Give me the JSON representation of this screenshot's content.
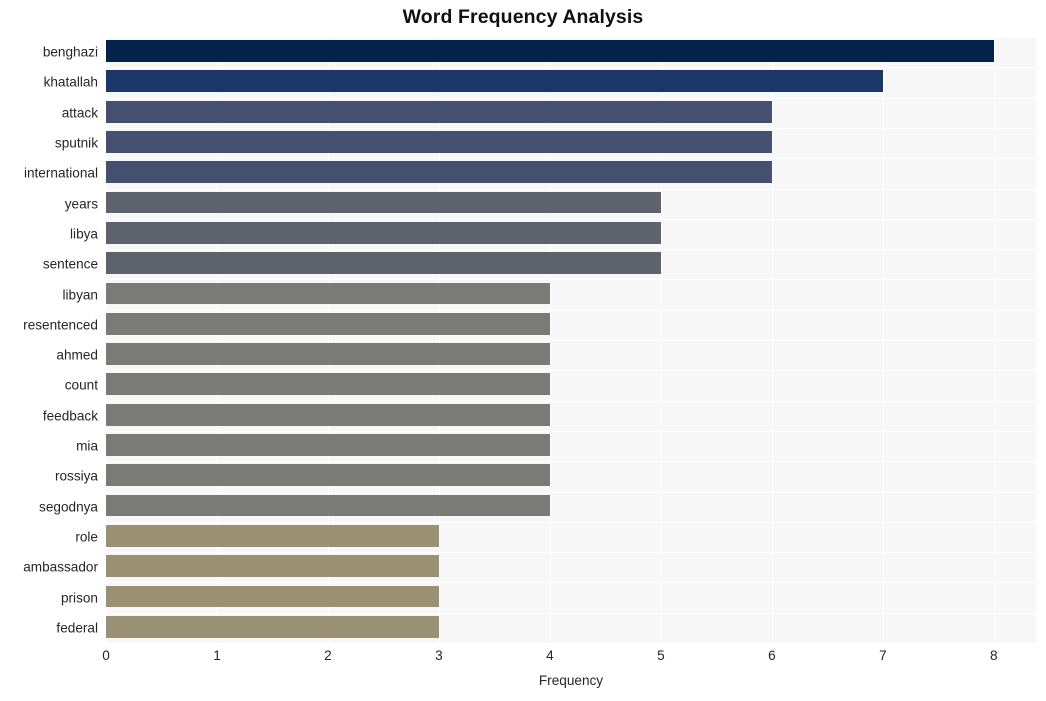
{
  "chart_data": {
    "type": "bar",
    "orientation": "horizontal",
    "title": "Word Frequency Analysis",
    "xlabel": "Frequency",
    "ylabel": "",
    "xlim": [
      0,
      8.38
    ],
    "ylim_categories": 20,
    "grid": true,
    "legend": "none",
    "xticks": [
      0,
      1,
      2,
      3,
      4,
      5,
      6,
      7,
      8
    ],
    "xtick_labels": [
      "0",
      "1",
      "2",
      "3",
      "4",
      "5",
      "6",
      "7",
      "8"
    ],
    "categories": [
      "benghazi",
      "khatallah",
      "attack",
      "sputnik",
      "international",
      "years",
      "libya",
      "sentence",
      "libyan",
      "resentenced",
      "ahmed",
      "count",
      "feedback",
      "mia",
      "rossiya",
      "segodnya",
      "role",
      "ambassador",
      "prison",
      "federal"
    ],
    "values": [
      8,
      7,
      6,
      6,
      6,
      5,
      5,
      5,
      4,
      4,
      4,
      4,
      4,
      4,
      4,
      4,
      3,
      3,
      3,
      3
    ],
    "bar_colors": [
      "#04234c",
      "#1b3669",
      "#455070",
      "#455070",
      "#455070",
      "#5e626d",
      "#5e626d",
      "#5e626d",
      "#7a7a77",
      "#7a7a77",
      "#7a7a77",
      "#7a7a77",
      "#7a7a77",
      "#7a7a77",
      "#7a7a77",
      "#7a7a77",
      "#9a9175",
      "#9a9175",
      "#9a9175",
      "#9a9175"
    ],
    "plot_background": "#f7f7f7",
    "grid_color": "#ffffff",
    "figure_background": "#ffffff",
    "text_color": "#262626"
  }
}
